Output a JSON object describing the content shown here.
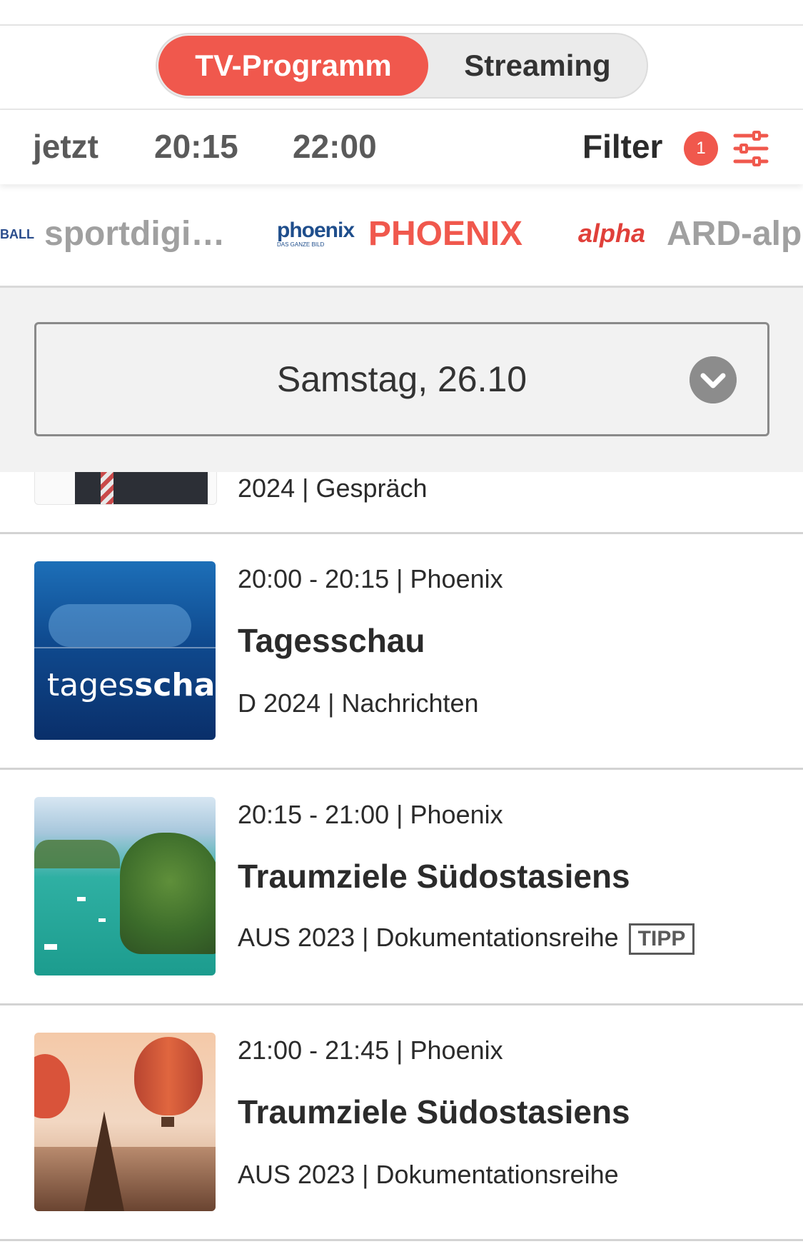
{
  "segmented": {
    "tv_label": "TV-Programm",
    "streaming_label": "Streaming"
  },
  "time_filters": {
    "now": "jetzt",
    "primetime": "20:15",
    "late": "22:00",
    "filter_label": "Filter",
    "filter_count": "1"
  },
  "channels": [
    {
      "name": "sportdigi…",
      "logo_text": "BALL",
      "active": false
    },
    {
      "name": "PHOENIX",
      "logo_text": "phoenix",
      "logo_sub": "DAS GANZE BILD",
      "active": true
    },
    {
      "name": "ARD-alp",
      "logo_text": "alpha",
      "active": false
    }
  ],
  "date_selector": {
    "value": "Samstag, 26.10"
  },
  "programs": [
    {
      "time": "",
      "title": "",
      "meta": "2024 | Gespräch"
    },
    {
      "time": "20:00 - 20:15 | Phoenix",
      "title": "Tagesschau",
      "meta": "D 2024 | Nachrichten",
      "thumb_text_a": "tages",
      "thumb_text_b": "schau"
    },
    {
      "time": "20:15 - 21:00 | Phoenix",
      "title": "Traumziele Südostasiens",
      "meta": "AUS 2023 | Dokumentationsreihe",
      "badge": "TIPP"
    },
    {
      "time": "21:00 - 21:45 | Phoenix",
      "title": "Traumziele Südostasiens",
      "meta": "AUS 2023 | Dokumentationsreihe"
    }
  ],
  "colors": {
    "accent": "#f0584d",
    "muted": "#a0a0a0"
  }
}
